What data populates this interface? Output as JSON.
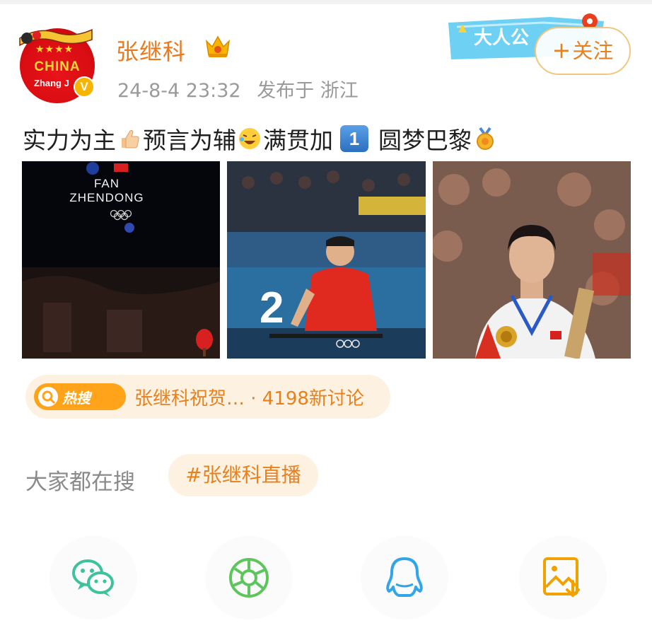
{
  "header": {
    "username": "张继科",
    "time": "24-8-4 23:32",
    "location": "发布于 浙江",
    "follow_plus": "+",
    "follow_label": "关注",
    "avatar_text": "CHINA",
    "avatar_sub": "Zhang J",
    "avatar_stars": "★★★★",
    "verified_mark": "V"
  },
  "post": {
    "text_1": "实力为主",
    "text_2": "预言为辅",
    "text_3": "满贯加",
    "keycap": "1",
    "text_4": "圆梦巴黎"
  },
  "images": {
    "photo1_caption_1": "FAN",
    "photo1_caption_2": "ZHENDONG",
    "photo2_number": "2"
  },
  "hot_search": {
    "badge": "热搜",
    "text": "张继科祝贺… · 4198新讨论"
  },
  "everyone_search": {
    "label": "大家都在搜",
    "tag": "#张继科直播"
  },
  "share": {
    "items": [
      "wechat-icon",
      "moments-icon",
      "qq-icon",
      "save-image-icon"
    ]
  },
  "colors": {
    "accent": "#e8801c",
    "hot_badge": "#ffa31a",
    "pill_bg": "#fdf1e1",
    "wechat": "#3ec29b",
    "moments": "#5cc65c",
    "qq": "#32a4e8",
    "save": "#f2a200"
  }
}
